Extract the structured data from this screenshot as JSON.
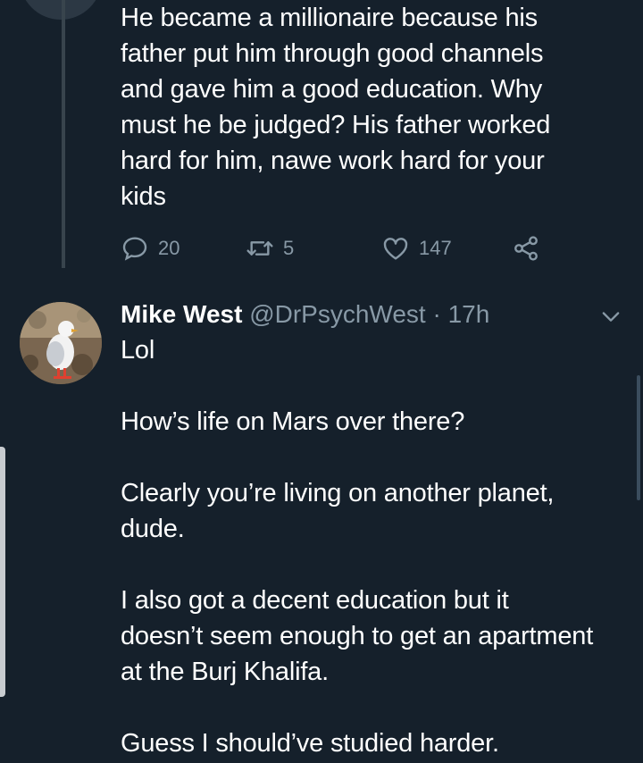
{
  "previous_tweet": {
    "text": "He became a millionaire because his\nfather put him through good channels\nand gave him a good education. Why\nmust he be judged? His father worked\nhard for him, nawe work hard for your\nkids",
    "actions": {
      "reply_count": "20",
      "retweet_count": "5",
      "like_count": "147"
    }
  },
  "reply_tweet": {
    "author_name": "Mike West",
    "handle": "@DrPsychWest",
    "separator": "·",
    "time": "17h",
    "text": "Lol\n\nHow’s life on Mars over there?\n\nClearly you’re living on another planet,\ndude.\n\nI also got a decent education but it\ndoesn’t seem enough to get an apartment\nat the Burj Khalifa.\n\nGuess I should’ve studied harder."
  },
  "colors": {
    "background": "#15202b",
    "text_primary": "#ffffff",
    "text_secondary": "#8899a6",
    "thread_line": "#38444d"
  },
  "icons": [
    "reply-icon",
    "retweet-icon",
    "like-icon",
    "share-icon",
    "chevron-down-icon"
  ]
}
